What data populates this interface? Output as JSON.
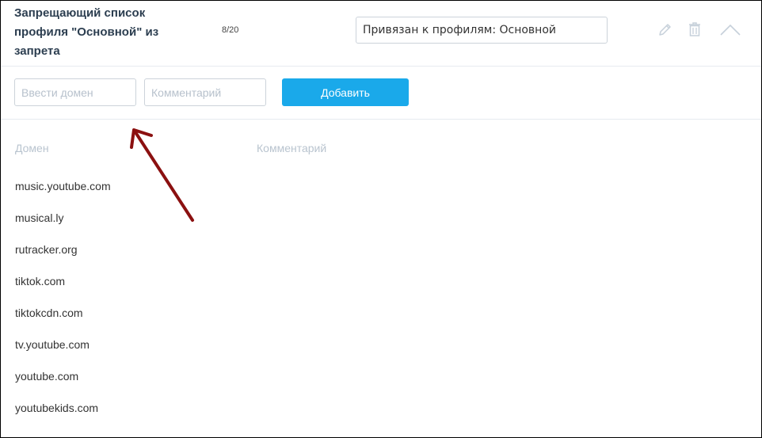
{
  "header": {
    "title": "Запрещающий список профиля \"Основной\" из запрета",
    "counter": "8/20",
    "profile_binding": "Привязан к профилям: Основной",
    "icons": [
      "pencil-icon",
      "trash-icon",
      "chevron-up-icon"
    ]
  },
  "form": {
    "domain_placeholder": "Ввести домен",
    "comment_placeholder": "Комментарий",
    "add_label": "Добавить"
  },
  "table": {
    "columns": [
      "Домен",
      "Комментарий"
    ],
    "rows": [
      "music.youtube.com",
      "musical.ly",
      "rutracker.org",
      "tiktok.com",
      "tiktokcdn.com",
      "tv.youtube.com",
      "youtube.com",
      "youtubekids.com"
    ]
  },
  "colors": {
    "accent": "#1aa9ea",
    "annotation_arrow": "#8b1010"
  }
}
